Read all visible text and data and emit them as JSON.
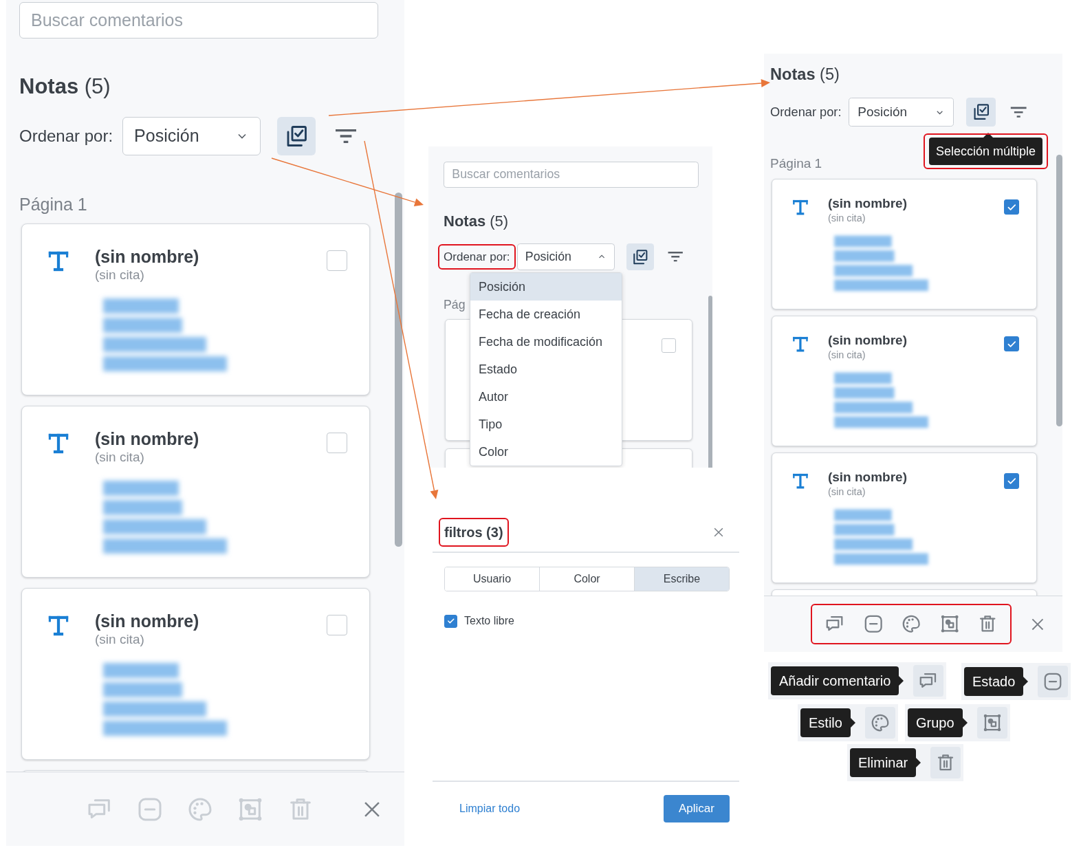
{
  "panels": [
    {
      "search": {
        "placeholder": "Buscar comentarios"
      },
      "title": "**Notas** (5)",
      "sort": {
        "label": "Ordenar por:",
        "value": "Posición",
        "expanded": false,
        "highlighted": false
      },
      "multi_select": {
        "selected": true
      },
      "page_label": "Página 1",
      "notes": [
        {
          "name": "(sin nombre)",
          "quote": "(sin cita)",
          "checked": false
        },
        {
          "name": "(sin nombre)",
          "quote": "(sin cita)",
          "checked": false
        },
        {
          "name": "(sin nombre)",
          "quote": "(sin cita)",
          "checked": false
        }
      ],
      "toolbar": {
        "enabled": false,
        "highlighted": false
      }
    },
    {
      "search": {
        "placeholder": "Buscar comentarios"
      },
      "title": "**Notas** (5)",
      "sort": {
        "label": "Ordenar por:",
        "value": "Posición",
        "expanded": true,
        "highlighted": true
      },
      "multi_select": {
        "selected": true
      },
      "page_label": "Pág",
      "menu": [
        {
          "label": "Posición",
          "selected": true
        },
        {
          "label": "Fecha de creación",
          "selected": false
        },
        {
          "label": "Fecha de modificación",
          "selected": false
        },
        {
          "label": "Estado",
          "selected": false
        },
        {
          "label": "Autor",
          "selected": false
        },
        {
          "label": "Tipo",
          "selected": false
        },
        {
          "label": "Color",
          "selected": false
        }
      ],
      "notes": [
        {
          "checked": false
        }
      ]
    },
    {
      "title": "**Notas** (5)",
      "sort": {
        "label": "Ordenar por:",
        "value": "Posición",
        "expanded": false,
        "highlighted": false
      },
      "multi_select": {
        "selected": true
      },
      "tooltip": {
        "label": "Selección múltiple",
        "highlighted": true
      },
      "page_label": "Página 1",
      "notes": [
        {
          "name": "(sin nombre)",
          "quote": "(sin cita)",
          "checked": true
        },
        {
          "name": "(sin nombre)",
          "quote": "(sin cita)",
          "checked": true
        },
        {
          "name": "(sin nombre)",
          "quote": "(sin cita)",
          "checked": true
        }
      ],
      "toolbar": {
        "enabled": true,
        "highlighted": true
      }
    }
  ],
  "filter_panel": {
    "title": "filtros (3)",
    "highlighted": true,
    "tabs": [
      {
        "label": "Usuario",
        "selected": false
      },
      {
        "label": "Color",
        "selected": false
      },
      {
        "label": "Escribe",
        "selected": true
      }
    ],
    "options": [
      {
        "label": "Texto libre",
        "checked": true
      }
    ],
    "clear_label": "Limpiar todo",
    "apply_label": "Aplicar"
  },
  "tooltips": [
    {
      "label": "Añadir comentario",
      "kind": "comment"
    },
    {
      "label": "Estado",
      "kind": "status"
    },
    {
      "label": "Estilo",
      "kind": "style"
    },
    {
      "label": "Grupo",
      "kind": "group"
    },
    {
      "label": "Eliminar",
      "kind": "delete"
    }
  ]
}
